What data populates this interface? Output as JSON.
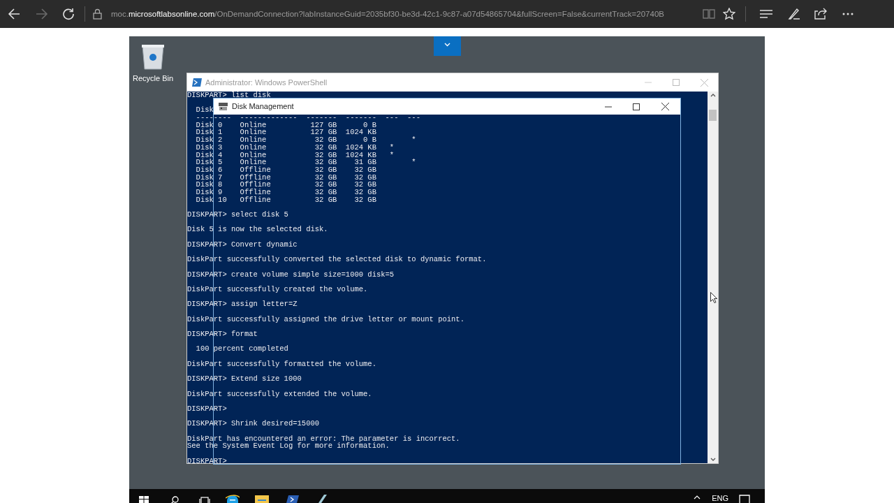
{
  "browser": {
    "address": "moc.**microsoftlabsonline.com**/OnDemandConnection?labInstanceGuid=2035bf30-be3d-42c1-9c87-a07d54865704&fullScreen=False&currentTrack=20740B"
  },
  "desktop": {
    "icons": [
      {
        "label": "Recycle Bin"
      }
    ]
  },
  "powershell": {
    "title": "Administrator: Windows PowerShell",
    "lines": [
      {
        "kind": "text",
        "text": "DISKPART> list disk"
      },
      {
        "kind": "blank"
      },
      {
        "kind": "text",
        "text": "  Disk"
      },
      {
        "kind": "text",
        "text": "  --------  -------------  -------  -------  ---  ---"
      },
      {
        "kind": "text",
        "text": "  Disk 0    Online          127 GB      0 B"
      },
      {
        "kind": "text",
        "text": "  Disk 1    Online          127 GB  1024 KB"
      },
      {
        "kind": "text",
        "text": "  Disk 2    Online           32 GB      0 B        *"
      },
      {
        "kind": "text",
        "text": "  Disk 3    Online           32 GB  1024 KB   *"
      },
      {
        "kind": "text",
        "text": "  Disk 4    Online           32 GB  1024 KB   *"
      },
      {
        "kind": "text",
        "text": "  Disk 5    Online           32 GB    31 GB        *"
      },
      {
        "kind": "text",
        "text": "  Disk 6    Offline          32 GB    32 GB"
      },
      {
        "kind": "text",
        "text": "  Disk 7    Offline          32 GB    32 GB"
      },
      {
        "kind": "text",
        "text": "  Disk 8    Offline          32 GB    32 GB"
      },
      {
        "kind": "text",
        "text": "  Disk 9    Offline          32 GB    32 GB"
      },
      {
        "kind": "text",
        "text": "  Disk 10   Offline          32 GB    32 GB"
      },
      {
        "kind": "blank"
      },
      {
        "kind": "text",
        "text": "DISKPART> select disk 5"
      },
      {
        "kind": "blank"
      },
      {
        "kind": "text",
        "text": "Disk 5 is now the selected disk."
      },
      {
        "kind": "blank"
      },
      {
        "kind": "text",
        "text": "DISKPART> Convert dynamic"
      },
      {
        "kind": "blank"
      },
      {
        "kind": "text",
        "text": "DiskPart successfully converted the selected disk to dynamic format."
      },
      {
        "kind": "blank"
      },
      {
        "kind": "text",
        "text": "DISKPART> create volume simple size=1000 disk=5"
      },
      {
        "kind": "blank"
      },
      {
        "kind": "text",
        "text": "DiskPart successfully created the volume."
      },
      {
        "kind": "blank"
      },
      {
        "kind": "text",
        "text": "DISKPART> assign letter=Z"
      },
      {
        "kind": "blank"
      },
      {
        "kind": "text",
        "text": "DiskPart successfully assigned the drive letter or mount point."
      },
      {
        "kind": "blank"
      },
      {
        "kind": "text",
        "text": "DISKPART> format"
      },
      {
        "kind": "blank"
      },
      {
        "kind": "text",
        "text": "  100 percent completed"
      },
      {
        "kind": "blank"
      },
      {
        "kind": "text",
        "text": "DiskPart successfully formatted the volume."
      },
      {
        "kind": "blank"
      },
      {
        "kind": "text",
        "text": "DISKPART> Extend size 1000"
      },
      {
        "kind": "blank"
      },
      {
        "kind": "text",
        "text": "DiskPart successfully extended the volume."
      },
      {
        "kind": "blank"
      },
      {
        "kind": "text",
        "text": "DISKPART>"
      },
      {
        "kind": "blank"
      },
      {
        "kind": "text",
        "text": "DISKPART> Shrink desired=15000"
      },
      {
        "kind": "blank"
      },
      {
        "kind": "text",
        "text": "DiskPart has encountered an error: The parameter is incorrect."
      },
      {
        "kind": "text",
        "text": "See the System Event Log for more information."
      },
      {
        "kind": "blank"
      },
      {
        "kind": "text",
        "text": "DISKPART>"
      }
    ]
  },
  "disk_management": {
    "title": "Disk Management"
  },
  "taskbar": {
    "language": "ENG"
  }
}
